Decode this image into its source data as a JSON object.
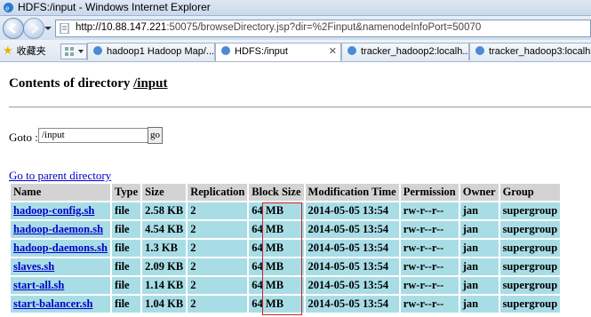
{
  "window": {
    "title": "HDFS:/input - Windows Internet Explorer"
  },
  "address": {
    "host": "http://10.88.147.221",
    "rest": ":50075/browseDirectory.jsp?dir=%2Finput&namenodeInfoPort=50070"
  },
  "favorites": {
    "label": "收藏夹"
  },
  "tabs": [
    {
      "label": "hadoop1 Hadoop Map/..."
    },
    {
      "label": "HDFS:/input"
    },
    {
      "label": "tracker_hadoop2:localh..."
    },
    {
      "label": "tracker_hadoop3:localh..."
    }
  ],
  "page": {
    "heading_prefix": "Contents of directory ",
    "heading_path": "/input",
    "goto_label": "Goto :",
    "goto_value": "/input",
    "go_label": "go",
    "parent_link": "Go to parent directory"
  },
  "table": {
    "headers": [
      "Name",
      "Type",
      "Size",
      "Replication",
      "Block Size",
      "Modification Time",
      "Permission",
      "Owner",
      "Group"
    ],
    "rows": [
      [
        "hadoop-config.sh",
        "file",
        "2.58 KB",
        "2",
        "64 MB",
        "2014-05-05 13:54",
        "rw-r--r--",
        "jan",
        "supergroup"
      ],
      [
        "hadoop-daemon.sh",
        "file",
        "4.54 KB",
        "2",
        "64 MB",
        "2014-05-05 13:54",
        "rw-r--r--",
        "jan",
        "supergroup"
      ],
      [
        "hadoop-daemons.sh",
        "file",
        "1.3 KB",
        "2",
        "64 MB",
        "2014-05-05 13:54",
        "rw-r--r--",
        "jan",
        "supergroup"
      ],
      [
        "slaves.sh",
        "file",
        "2.09 KB",
        "2",
        "64 MB",
        "2014-05-05 13:54",
        "rw-r--r--",
        "jan",
        "supergroup"
      ],
      [
        "start-all.sh",
        "file",
        "1.14 KB",
        "2",
        "64 MB",
        "2014-05-05 13:54",
        "rw-r--r--",
        "jan",
        "supergroup"
      ],
      [
        "start-balancer.sh",
        "file",
        "1.04 KB",
        "2",
        "64 MB",
        "2014-05-05 13:54",
        "rw-r--r--",
        "jan",
        "supergroup"
      ]
    ]
  }
}
